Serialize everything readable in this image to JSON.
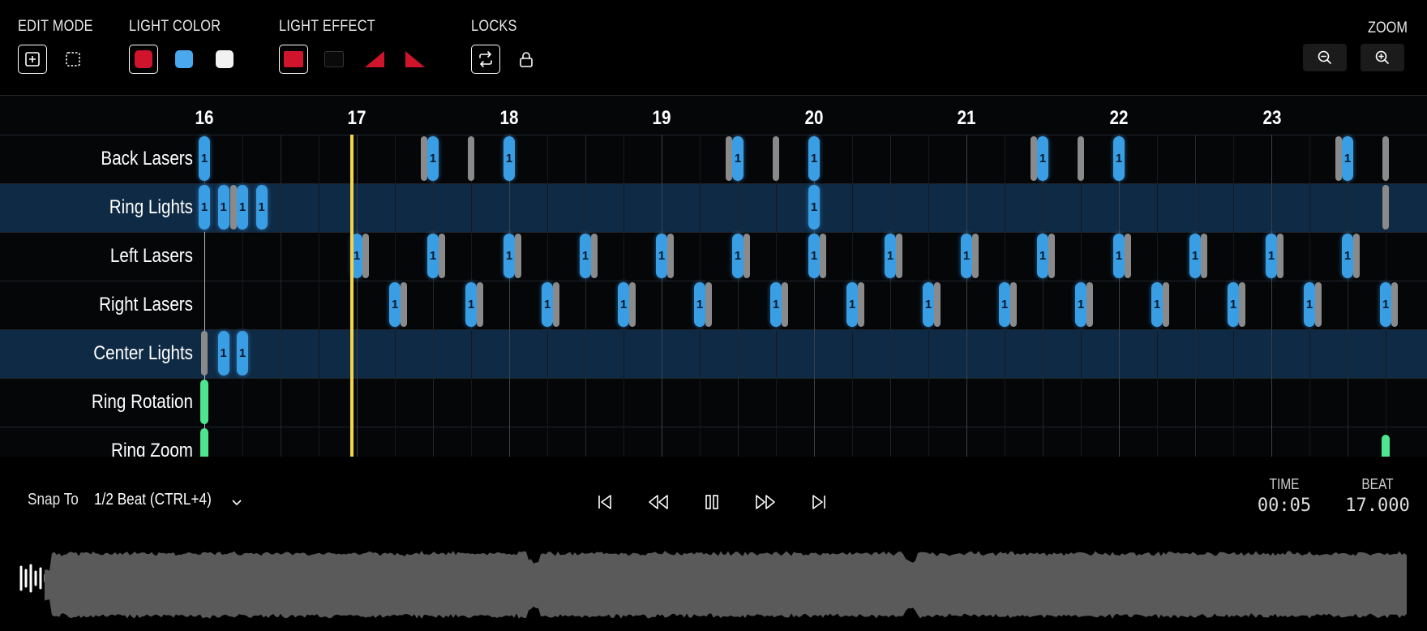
{
  "toolbar": {
    "edit_mode_label": "EDIT MODE",
    "light_color_label": "LIGHT COLOR",
    "light_effect_label": "LIGHT EFFECT",
    "locks_label": "LOCKS",
    "zoom_label": "ZOOM",
    "colors": {
      "red": "#d0142b",
      "blue": "#4aa9ee",
      "white": "#f2f2f2"
    }
  },
  "timeline": {
    "beats": [
      "16",
      "17",
      "18",
      "19",
      "20",
      "21",
      "22",
      "23"
    ],
    "playhead_color": "#f4d44a",
    "event_label": "1",
    "rows": [
      {
        "label": "Back Lasers"
      },
      {
        "label": "Ring Lights"
      },
      {
        "label": "Left Lasers"
      },
      {
        "label": "Right Lasers"
      },
      {
        "label": "Center Lights"
      },
      {
        "label": "Ring Rotation"
      },
      {
        "label": "Ring Zoom"
      }
    ]
  },
  "transport": {
    "snap_label": "Snap To",
    "snap_value": "1/2 Beat (CTRL+4)",
    "time_label": "TIME",
    "time_value": "00:05",
    "beat_label": "BEAT",
    "beat_value": "17.000"
  }
}
